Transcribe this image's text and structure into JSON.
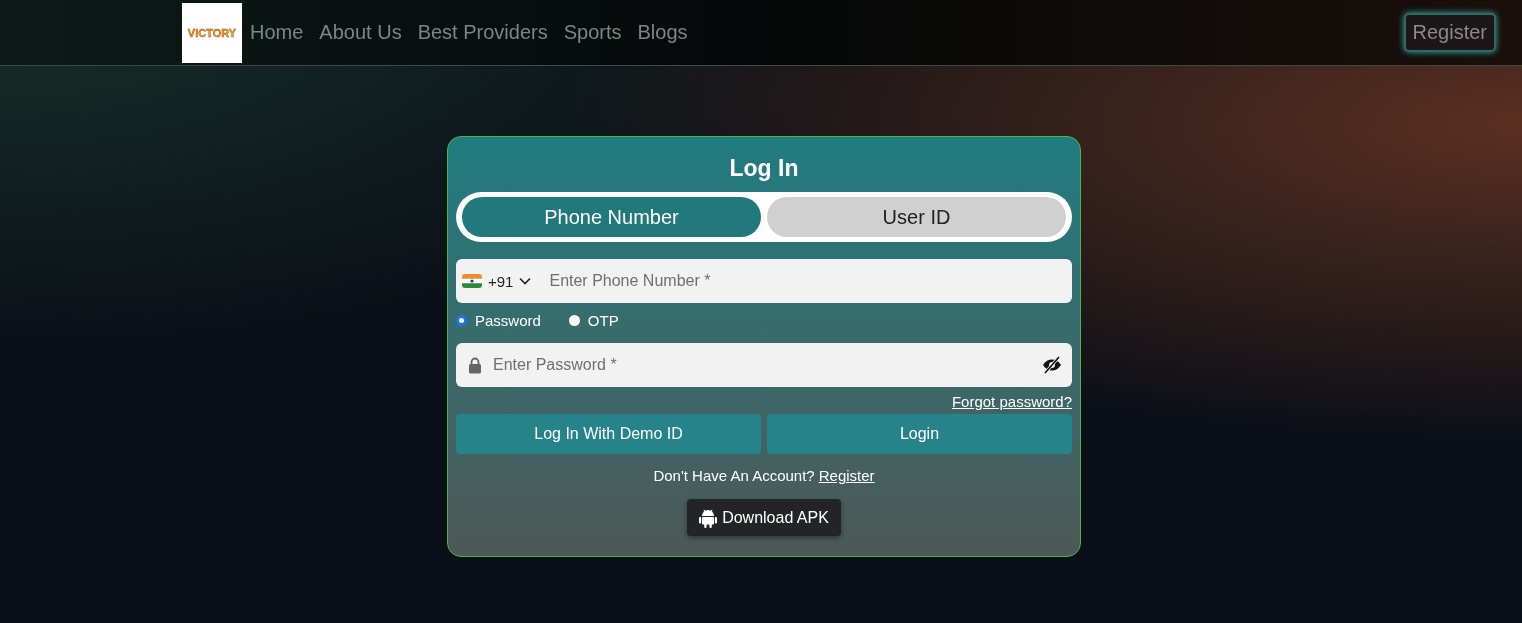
{
  "nav": {
    "logo": {
      "text": "VICTORY"
    },
    "links": [
      "Home",
      "About Us",
      "Best Providers",
      "Sports",
      "Blogs"
    ],
    "register_button": "Register"
  },
  "login": {
    "title": "Log In",
    "tabs": [
      {
        "label": "Phone Number",
        "selected": true
      },
      {
        "label": "User ID",
        "selected": false
      }
    ],
    "phone": {
      "country_code": "+91",
      "placeholder": "Enter Phone Number *"
    },
    "methods": [
      {
        "label": "Password",
        "selected": true
      },
      {
        "label": "OTP",
        "selected": false
      }
    ],
    "password": {
      "placeholder": "Enter Password *"
    },
    "forgot_link": "Forgot password?",
    "buttons": [
      "Log In With Demo ID",
      "Login"
    ],
    "signup_prompt": "Don't Have An Account?",
    "signup_link": "Register",
    "download_button": "Download APK"
  }
}
